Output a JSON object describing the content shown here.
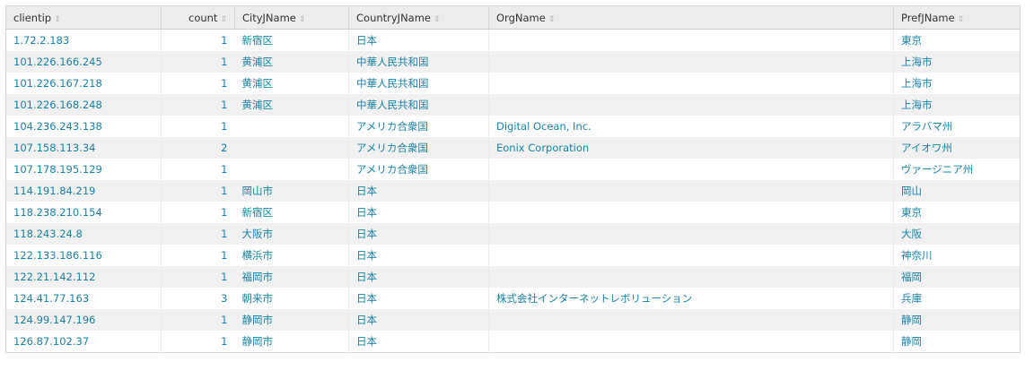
{
  "columns": [
    {
      "key": "clientip",
      "label": "clientip",
      "align": "left"
    },
    {
      "key": "count",
      "label": "count",
      "align": "right"
    },
    {
      "key": "city",
      "label": "CityJName",
      "align": "left"
    },
    {
      "key": "country",
      "label": "CountryJName",
      "align": "left"
    },
    {
      "key": "org",
      "label": "OrgName",
      "align": "left"
    },
    {
      "key": "pref",
      "label": "PrefJName",
      "align": "left"
    }
  ],
  "sort_icon": "sort-icon",
  "rows": [
    {
      "clientip": "1.72.2.183",
      "count": "1",
      "city": "新宿区",
      "country": "日本",
      "org": "",
      "pref": "東京"
    },
    {
      "clientip": "101.226.166.245",
      "count": "1",
      "city": "黄浦区",
      "country": "中華人民共和国",
      "org": "",
      "pref": "上海市"
    },
    {
      "clientip": "101.226.167.218",
      "count": "1",
      "city": "黄浦区",
      "country": "中華人民共和国",
      "org": "",
      "pref": "上海市"
    },
    {
      "clientip": "101.226.168.248",
      "count": "1",
      "city": "黄浦区",
      "country": "中華人民共和国",
      "org": "",
      "pref": "上海市"
    },
    {
      "clientip": "104.236.243.138",
      "count": "1",
      "city": "",
      "country": "アメリカ合衆国",
      "org": "Digital Ocean, Inc.",
      "pref": "アラバマ州"
    },
    {
      "clientip": "107.158.113.34",
      "count": "2",
      "city": "",
      "country": "アメリカ合衆国",
      "org": "Eonix Corporation",
      "pref": "アイオワ州"
    },
    {
      "clientip": "107.178.195.129",
      "count": "1",
      "city": "",
      "country": "アメリカ合衆国",
      "org": "",
      "pref": "ヴァージニア州"
    },
    {
      "clientip": "114.191.84.219",
      "count": "1",
      "city": "岡山市",
      "country": "日本",
      "org": "",
      "pref": "岡山"
    },
    {
      "clientip": "118.238.210.154",
      "count": "1",
      "city": "新宿区",
      "country": "日本",
      "org": "",
      "pref": "東京"
    },
    {
      "clientip": "118.243.24.8",
      "count": "1",
      "city": "大阪市",
      "country": "日本",
      "org": "",
      "pref": "大阪"
    },
    {
      "clientip": "122.133.186.116",
      "count": "1",
      "city": "横浜市",
      "country": "日本",
      "org": "",
      "pref": "神奈川"
    },
    {
      "clientip": "122.21.142.112",
      "count": "1",
      "city": "福岡市",
      "country": "日本",
      "org": "",
      "pref": "福岡"
    },
    {
      "clientip": "124.41.77.163",
      "count": "3",
      "city": "朝来市",
      "country": "日本",
      "org": "株式会社インターネットレボリューション",
      "pref": "兵庫"
    },
    {
      "clientip": "124.99.147.196",
      "count": "1",
      "city": "静岡市",
      "country": "日本",
      "org": "",
      "pref": "静岡"
    },
    {
      "clientip": "126.87.102.37",
      "count": "1",
      "city": "静岡市",
      "country": "日本",
      "org": "",
      "pref": "静岡"
    }
  ]
}
